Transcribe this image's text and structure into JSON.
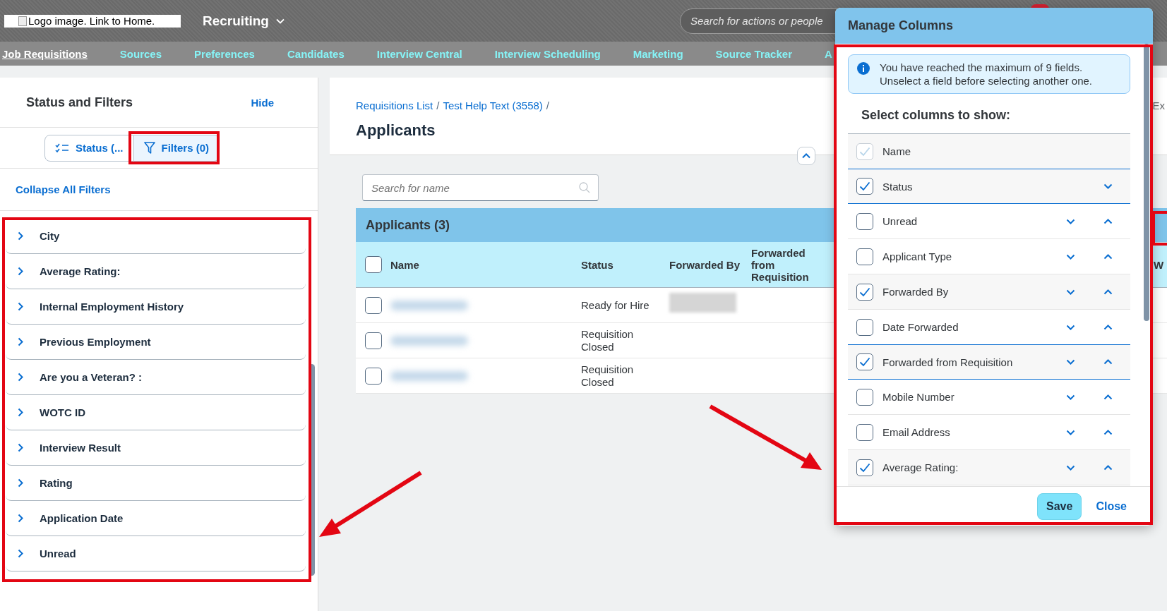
{
  "top_bar": {
    "logo_alt": "Logo image. Link to Home.",
    "module": "Recruiting",
    "search": {
      "placeholder": "Search for actions or people"
    }
  },
  "nav": [
    {
      "label": "Job Requisitions",
      "selected": true
    },
    {
      "label": "Sources",
      "selected": false
    },
    {
      "label": "Preferences",
      "selected": false
    },
    {
      "label": "Candidates",
      "selected": false
    },
    {
      "label": "Interview Central",
      "selected": false
    },
    {
      "label": "Interview Scheduling",
      "selected": false
    },
    {
      "label": "Marketing",
      "selected": false
    },
    {
      "label": "Source Tracker",
      "selected": false
    },
    {
      "label": "A",
      "selected": false
    }
  ],
  "filter_panel": {
    "title": "Status and Filters",
    "hide_link": "Hide",
    "segments": [
      {
        "kind": "status",
        "label": "Status (...",
        "selected": false
      },
      {
        "kind": "filters",
        "label": "Filters (0)",
        "selected": true
      }
    ],
    "collapse_link": "Collapse All Filters",
    "filters": [
      {
        "label": "City",
        "expanded": false
      },
      {
        "label": "Average Rating:",
        "expanded": false
      },
      {
        "label": "Internal Employment History",
        "expanded": false
      },
      {
        "label": "Previous Employment",
        "expanded": false
      },
      {
        "label": "Are you a Veteran? :",
        "expanded": false
      },
      {
        "label": "WOTC ID",
        "expanded": false
      },
      {
        "label": "Interview Result",
        "expanded": false
      },
      {
        "label": "Rating",
        "expanded": false
      },
      {
        "label": "Application Date",
        "expanded": false
      },
      {
        "label": "Unread",
        "expanded": false
      }
    ]
  },
  "breadcrumbs": [
    {
      "label": "Requisitions List",
      "separator": "/"
    },
    {
      "label": "Test Help Text (3558)",
      "separator": "/"
    }
  ],
  "header_fragment": "Ex",
  "page_title": "Applicants",
  "search": {
    "placeholder": "Search for name"
  },
  "table": {
    "title": "Applicants (3)",
    "all_checked": false,
    "columns": [
      "Name",
      "Status",
      "Forwarded By",
      "Forwarded from Requisition",
      "W"
    ],
    "rows": [
      {
        "checked": false,
        "status": "Ready for Hire",
        "forwarded_by_blurred": true
      },
      {
        "checked": false,
        "status": "Requisition Closed",
        "forwarded_by_blurred": false
      },
      {
        "checked": false,
        "status": "Requisition Closed",
        "forwarded_by_blurred": false
      }
    ]
  },
  "dialog": {
    "title": "Manage Columns",
    "info": "You have reached the maximum of 9 fields. Unselect a field before selecting another one.",
    "subtitle": "Select columns to show:",
    "columns": [
      {
        "label": "Name",
        "checked": true,
        "disabled": true,
        "selected": false,
        "move_down": false,
        "move_up": false
      },
      {
        "label": "Status",
        "checked": true,
        "disabled": false,
        "selected": true,
        "move_down": true,
        "move_up": false
      },
      {
        "label": "Unread",
        "checked": false,
        "disabled": false,
        "selected": false,
        "move_down": true,
        "move_up": true
      },
      {
        "label": "Applicant Type",
        "checked": false,
        "disabled": false,
        "selected": false,
        "move_down": true,
        "move_up": true
      },
      {
        "label": "Forwarded By",
        "checked": true,
        "disabled": false,
        "selected": false,
        "move_down": true,
        "move_up": true
      },
      {
        "label": "Date Forwarded",
        "checked": false,
        "disabled": false,
        "selected": false,
        "move_down": true,
        "move_up": true
      },
      {
        "label": "Forwarded from Requisition",
        "checked": true,
        "disabled": false,
        "selected": true,
        "move_down": true,
        "move_up": true
      },
      {
        "label": "Mobile Number",
        "checked": false,
        "disabled": false,
        "selected": false,
        "move_down": true,
        "move_up": true
      },
      {
        "label": "Email Address",
        "checked": false,
        "disabled": false,
        "selected": false,
        "move_down": true,
        "move_up": true
      },
      {
        "label": "Average Rating:",
        "checked": true,
        "disabled": false,
        "selected": false,
        "move_down": true,
        "move_up": true
      }
    ],
    "save": "Save",
    "close": "Close"
  }
}
